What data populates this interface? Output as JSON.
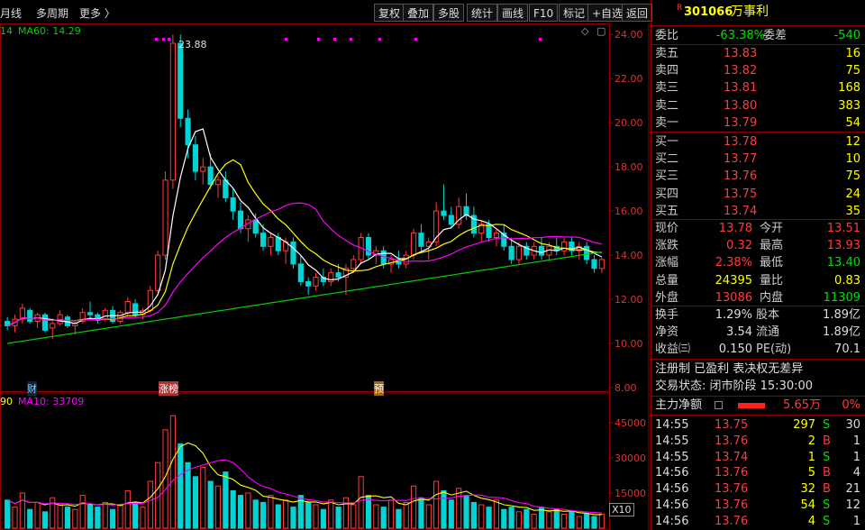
{
  "toolbar": {
    "left": [
      "月线",
      "多周期",
      "更多 〉"
    ],
    "right": [
      "复权",
      "叠加",
      "多股",
      "统计",
      "画线",
      "F10",
      "标记",
      "+自选",
      "返回"
    ]
  },
  "main_chart": {
    "legend_prefix": "14",
    "ma60_label": "MA60: 14.29",
    "high_marker": "23.88",
    "yaxis": [
      "24.00",
      "22.00",
      "20.00",
      "18.00",
      "16.00",
      "14.00",
      "12.00",
      "10.00",
      "8.00"
    ],
    "event_tags": [
      "财",
      "涨榜",
      "预"
    ]
  },
  "volume_chart": {
    "legend_prefix": "90",
    "ma10_label": "MA10: 33709",
    "yaxis": [
      "45000",
      "30000",
      "15000"
    ],
    "unit": "X10"
  },
  "stock": {
    "code": "301066",
    "name": "万事利",
    "r_mark": "R"
  },
  "weibi": {
    "label": "委比",
    "value": "-63.38%",
    "label2": "委差",
    "value2": "-540"
  },
  "sell": [
    {
      "label": "卖五",
      "price": "13.83",
      "vol": "16"
    },
    {
      "label": "卖四",
      "price": "13.82",
      "vol": "75"
    },
    {
      "label": "卖三",
      "price": "13.81",
      "vol": "168"
    },
    {
      "label": "卖二",
      "price": "13.80",
      "vol": "383"
    },
    {
      "label": "卖一",
      "price": "13.79",
      "vol": "54"
    }
  ],
  "buy": [
    {
      "label": "买一",
      "price": "13.78",
      "vol": "12"
    },
    {
      "label": "买二",
      "price": "13.77",
      "vol": "10"
    },
    {
      "label": "买三",
      "price": "13.76",
      "vol": "75"
    },
    {
      "label": "买四",
      "price": "13.75",
      "vol": "24"
    },
    {
      "label": "买五",
      "price": "13.74",
      "vol": "35"
    }
  ],
  "quote": [
    {
      "l1": "现价",
      "v1": "13.78",
      "l2": "今开",
      "v2": "13.51",
      "c1": "red",
      "c2": "red"
    },
    {
      "l1": "涨跌",
      "v1": "0.32",
      "l2": "最高",
      "v2": "13.93",
      "c1": "red",
      "c2": "red"
    },
    {
      "l1": "涨幅",
      "v1": "2.38%",
      "l2": "最低",
      "v2": "13.40",
      "c1": "red",
      "c2": "grn"
    },
    {
      "l1": "总量",
      "v1": "24395",
      "l2": "量比",
      "v2": "0.83",
      "c1": "yel",
      "c2": "yel"
    },
    {
      "l1": "外盘",
      "v1": "13086",
      "l2": "内盘",
      "v2": "11309",
      "c1": "red",
      "c2": "grn"
    }
  ],
  "fin": [
    {
      "l1": "换手",
      "v1": "1.29%",
      "l2": "股本",
      "v2": "1.89亿"
    },
    {
      "l1": "净资",
      "v1": "3.54",
      "l2": "流通",
      "v2": "1.89亿"
    },
    {
      "l1": "收益㈢",
      "v1": "0.150",
      "l2": "PE(动)",
      "v2": "70.1"
    }
  ],
  "info": {
    "line1": "注册制 已盈利 表决权无差异",
    "line2": "交易状态: 闭市阶段 15:30:00"
  },
  "flow": {
    "label": "主力净额",
    "value": "5.65万",
    "pct": "0%"
  },
  "ticks": [
    {
      "time": "14:55",
      "price": "13.75",
      "vol": "297",
      "side": "S",
      "n": "30"
    },
    {
      "time": "14:55",
      "price": "13.76",
      "vol": "2",
      "side": "B",
      "n": "1"
    },
    {
      "time": "14:55",
      "price": "13.74",
      "vol": "1",
      "side": "S",
      "n": "1"
    },
    {
      "time": "14:56",
      "price": "13.76",
      "vol": "5",
      "side": "B",
      "n": "4"
    },
    {
      "time": "14:56",
      "price": "13.76",
      "vol": "32",
      "side": "B",
      "n": "21"
    },
    {
      "time": "14:56",
      "price": "13.76",
      "vol": "54",
      "side": "S",
      "n": "12"
    },
    {
      "time": "14:56",
      "price": "13.76",
      "vol": "4",
      "side": "S",
      "n": "1"
    }
  ],
  "colors": {
    "up": "#ff3b3b",
    "down": "#00d4d4",
    "ma5": "#ffffff",
    "ma10": "#ffff00",
    "ma20": "#ff00ff",
    "ma60": "#00d000",
    "frame": "#8b0000"
  },
  "chart_data": {
    "type": "candlestick",
    "ylim": [
      8,
      24.5
    ],
    "candles": [
      [
        11.0,
        11.2,
        10.6,
        10.8
      ],
      [
        10.8,
        11.3,
        10.5,
        11.1
      ],
      [
        11.1,
        11.8,
        10.9,
        11.6
      ],
      [
        11.5,
        11.6,
        10.9,
        11.0
      ],
      [
        11.0,
        11.4,
        10.7,
        11.3
      ],
      [
        11.3,
        11.4,
        10.5,
        10.6
      ],
      [
        10.7,
        11.0,
        10.2,
        10.9
      ],
      [
        10.9,
        11.5,
        10.8,
        11.3
      ],
      [
        11.2,
        11.3,
        10.7,
        10.8
      ],
      [
        10.8,
        11.0,
        10.4,
        10.9
      ],
      [
        11.0,
        11.6,
        10.9,
        11.4
      ],
      [
        11.4,
        11.9,
        11.1,
        11.3
      ],
      [
        11.3,
        11.4,
        10.9,
        11.1
      ],
      [
        11.1,
        11.6,
        11.0,
        11.5
      ],
      [
        11.5,
        11.7,
        10.9,
        11.0
      ],
      [
        11.0,
        11.5,
        10.9,
        11.4
      ],
      [
        11.4,
        12.1,
        11.3,
        11.9
      ],
      [
        11.8,
        12.0,
        11.2,
        11.3
      ],
      [
        11.3,
        11.6,
        11.1,
        11.5
      ],
      [
        11.5,
        12.6,
        11.4,
        12.4
      ],
      [
        12.4,
        14.2,
        12.3,
        14.0
      ],
      [
        14.0,
        17.8,
        13.8,
        17.4
      ],
      [
        17.4,
        24.0,
        17.0,
        23.6
      ],
      [
        23.6,
        24.0,
        19.8,
        20.2
      ],
      [
        20.2,
        20.6,
        18.4,
        19.0
      ],
      [
        19.0,
        19.4,
        17.4,
        17.8
      ],
      [
        17.8,
        18.4,
        17.2,
        18.0
      ],
      [
        18.0,
        18.6,
        17.0,
        17.2
      ],
      [
        17.2,
        17.6,
        16.6,
        17.4
      ],
      [
        17.4,
        17.8,
        16.4,
        16.6
      ],
      [
        16.6,
        17.0,
        15.6,
        16.0
      ],
      [
        16.0,
        16.4,
        15.0,
        15.2
      ],
      [
        15.2,
        15.8,
        14.6,
        15.6
      ],
      [
        15.6,
        15.9,
        14.8,
        15.0
      ],
      [
        15.0,
        15.4,
        14.2,
        14.4
      ],
      [
        14.4,
        15.0,
        14.0,
        14.8
      ],
      [
        14.8,
        15.0,
        14.0,
        14.2
      ],
      [
        14.2,
        14.8,
        13.6,
        14.6
      ],
      [
        14.6,
        14.8,
        13.4,
        13.6
      ],
      [
        13.6,
        14.0,
        12.6,
        12.8
      ],
      [
        12.8,
        13.0,
        12.2,
        12.6
      ],
      [
        12.6,
        13.2,
        12.4,
        13.0
      ],
      [
        13.0,
        13.4,
        12.6,
        12.8
      ],
      [
        12.8,
        13.4,
        12.6,
        13.2
      ],
      [
        13.2,
        13.6,
        12.8,
        13.0
      ],
      [
        13.0,
        13.6,
        12.2,
        13.4
      ],
      [
        13.4,
        14.0,
        13.2,
        13.8
      ],
      [
        13.8,
        15.0,
        13.6,
        14.8
      ],
      [
        14.8,
        15.0,
        13.8,
        14.0
      ],
      [
        14.0,
        14.4,
        13.6,
        14.2
      ],
      [
        14.2,
        14.4,
        13.4,
        13.6
      ],
      [
        13.6,
        14.0,
        13.2,
        13.8
      ],
      [
        13.8,
        14.2,
        13.4,
        13.6
      ],
      [
        13.6,
        14.2,
        13.4,
        14.0
      ],
      [
        14.0,
        15.2,
        13.8,
        15.0
      ],
      [
        15.0,
        15.4,
        14.2,
        14.4
      ],
      [
        14.4,
        14.8,
        13.8,
        14.6
      ],
      [
        14.6,
        16.4,
        14.4,
        16.0
      ],
      [
        16.0,
        17.2,
        15.6,
        15.8
      ],
      [
        15.8,
        16.2,
        15.2,
        15.4
      ],
      [
        15.4,
        16.6,
        15.2,
        16.2
      ],
      [
        16.2,
        16.8,
        15.6,
        15.8
      ],
      [
        15.8,
        16.2,
        14.8,
        15.0
      ],
      [
        15.0,
        15.6,
        14.6,
        15.4
      ],
      [
        15.4,
        15.6,
        14.6,
        14.8
      ],
      [
        14.8,
        15.2,
        14.4,
        15.0
      ],
      [
        15.0,
        15.4,
        14.2,
        14.4
      ],
      [
        14.4,
        14.8,
        13.6,
        13.8
      ],
      [
        13.8,
        14.6,
        13.6,
        14.4
      ],
      [
        14.4,
        14.6,
        13.8,
        14.0
      ],
      [
        14.0,
        14.6,
        13.8,
        14.4
      ],
      [
        14.4,
        14.8,
        13.8,
        14.0
      ],
      [
        14.0,
        14.6,
        13.8,
        14.4
      ],
      [
        14.4,
        14.8,
        14.0,
        14.2
      ],
      [
        14.2,
        14.8,
        14.0,
        14.6
      ],
      [
        14.6,
        14.8,
        14.0,
        14.2
      ],
      [
        14.2,
        14.6,
        13.8,
        14.4
      ],
      [
        14.4,
        14.6,
        13.6,
        13.8
      ],
      [
        13.8,
        14.0,
        13.2,
        13.4
      ],
      [
        13.4,
        13.9,
        13.2,
        13.8
      ]
    ],
    "volumes": [
      12,
      9,
      15,
      8,
      11,
      7,
      13,
      10,
      9,
      8,
      14,
      10,
      9,
      11,
      8,
      10,
      16,
      11,
      9,
      20,
      28,
      42,
      48,
      36,
      28,
      22,
      26,
      20,
      18,
      24,
      16,
      14,
      15,
      12,
      11,
      14,
      10,
      12,
      9,
      14,
      11,
      10,
      8,
      12,
      9,
      13,
      10,
      22,
      14,
      10,
      9,
      12,
      8,
      11,
      18,
      13,
      10,
      20,
      16,
      12,
      17,
      14,
      11,
      10,
      9,
      12,
      8,
      9,
      7,
      8,
      6,
      9,
      7,
      8,
      6,
      7,
      5,
      6,
      5,
      6
    ],
    "vol_ylim": [
      0,
      50
    ]
  }
}
